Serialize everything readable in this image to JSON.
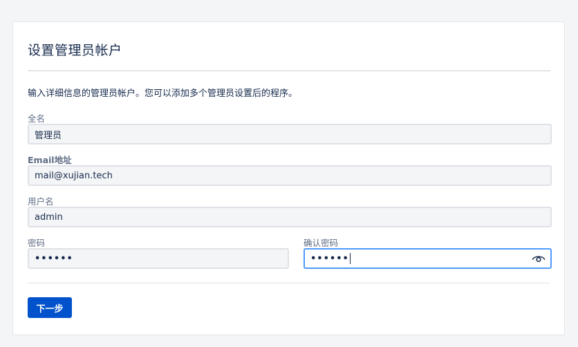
{
  "page": {
    "title": "设置管理员帐户",
    "intro": "输入详细信息的管理员帐户。您可以添加多个管理员设置后的程序。"
  },
  "form": {
    "fullname": {
      "label": "全名",
      "value": "管理员"
    },
    "email": {
      "label": "Email地址",
      "value": "mail@xujian.tech"
    },
    "username": {
      "label": "用户名",
      "value": "admin"
    },
    "password": {
      "label": "密码",
      "value": "••••••"
    },
    "confirm_password": {
      "label": "确认密码",
      "value": "••••••"
    }
  },
  "icons": {
    "show_password": "eye-icon"
  },
  "actions": {
    "next_label": "下一步"
  },
  "colors": {
    "primary": "#0052cc",
    "focus_border": "#4c9aff"
  }
}
